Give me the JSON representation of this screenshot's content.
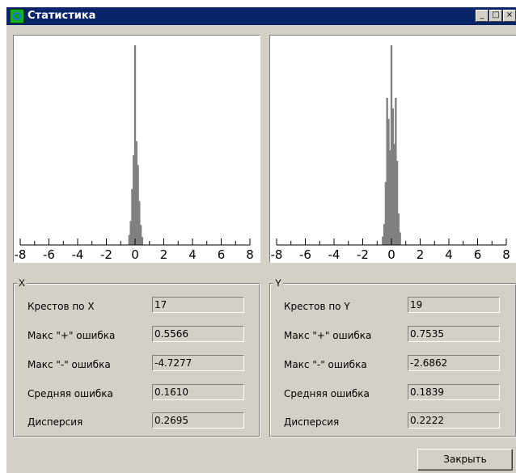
{
  "window": {
    "title": "Статистика",
    "minimize_glyph": "_",
    "maximize_glyph": "□",
    "close_glyph": "×"
  },
  "charts": [
    {
      "type": "histogram",
      "axis": "X",
      "xlim": [
        -8,
        8
      ],
      "tick_labels": [
        "-8",
        "-6",
        "-4",
        "-2",
        "0",
        "2",
        "4",
        "6",
        "8"
      ],
      "bars": [
        [
          -0.4,
          5
        ],
        [
          -0.3,
          12
        ],
        [
          -0.2,
          28
        ],
        [
          -0.1,
          45
        ],
        [
          0,
          100
        ],
        [
          0.1,
          52
        ],
        [
          0.2,
          40
        ],
        [
          0.3,
          22
        ],
        [
          0.4,
          10
        ],
        [
          0.5,
          4
        ]
      ]
    },
    {
      "type": "histogram",
      "axis": "Y",
      "xlim": [
        -8,
        8
      ],
      "tick_labels": [
        "-8",
        "-6",
        "-4",
        "-2",
        "0",
        "2",
        "4",
        "6",
        "8"
      ],
      "bars": [
        [
          -0.6,
          4
        ],
        [
          -0.5,
          10
        ],
        [
          -0.4,
          30
        ],
        [
          -0.3,
          70
        ],
        [
          -0.2,
          60
        ],
        [
          -0.1,
          45
        ],
        [
          0,
          95
        ],
        [
          0.1,
          65
        ],
        [
          0.2,
          48
        ],
        [
          0.3,
          70
        ],
        [
          0.4,
          40
        ],
        [
          0.5,
          15
        ],
        [
          0.6,
          6
        ]
      ]
    }
  ],
  "groups": [
    {
      "title": "X",
      "rows": [
        {
          "label": "Крестов по X",
          "value": "17"
        },
        {
          "label": "Макс \"+\" ошибка",
          "value": "0.5566"
        },
        {
          "label": "Макс \"-\" ошибка",
          "value": "-4.7277"
        },
        {
          "label": "Средняя ошибка",
          "value": "0.1610"
        },
        {
          "label": "Дисперсия",
          "value": "0.2695"
        }
      ]
    },
    {
      "title": "Y",
      "rows": [
        {
          "label": "Крестов по Y",
          "value": "19"
        },
        {
          "label": "Макс \"+\" ошибка",
          "value": "0.7535"
        },
        {
          "label": "Макс \"-\" ошибка",
          "value": "-2.6862"
        },
        {
          "label": "Средняя ошибка",
          "value": "0.1839"
        },
        {
          "label": "Дисперсия",
          "value": "0.2222"
        }
      ]
    }
  ],
  "close_button": "Закрыть",
  "colors": {
    "titlebar": "#0a246a",
    "panel": "#d4d0c8",
    "bar": "#808080"
  }
}
